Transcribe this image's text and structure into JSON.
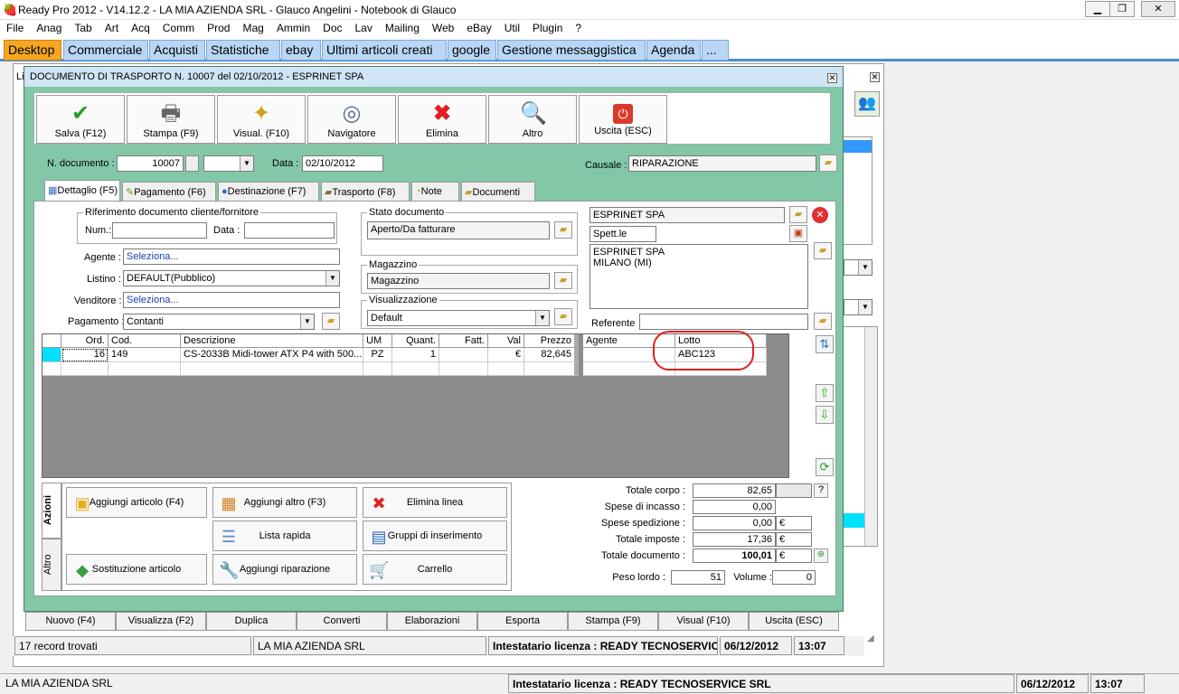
{
  "window": {
    "title": "Ready Pro 2012 - V14.12.2 - LA MIA AZIENDA SRL - Glauco Angelini - Notebook di Glauco"
  },
  "menu": [
    "File",
    "Anag",
    "Tab",
    "Art",
    "Acq",
    "Comm",
    "Prod",
    "Mag",
    "Ammin",
    "Doc",
    "Lav",
    "Mailing",
    "Web",
    "eBay",
    "Util",
    "Plugin",
    "?"
  ],
  "tabs": [
    "Desktop",
    "Commerciale",
    "Acquisti",
    "Statistiche",
    "ebay",
    "Ultimi articoli creati",
    "google",
    "Gestione messaggistica",
    "Agenda",
    "..."
  ],
  "bg": {
    "partial_label": "Li"
  },
  "dialog": {
    "title": "DOCUMENTO DI TRASPORTO N. 10007  del 02/10/2012 - ESPRINET SPA",
    "toolbar": [
      "Salva (F12)",
      "Stampa (F9)",
      "Visual. (F10)",
      "Navigatore",
      "Elimina",
      "Altro",
      "Uscita (ESC)"
    ],
    "ndoc_label": "N. documento :",
    "ndoc_value": "10007",
    "data_label": "Data :",
    "data_value": "02/10/2012",
    "causale_label": "Causale :",
    "causale_value": "RIPARAZIONE",
    "tabs": [
      "Dettaglio (F5)",
      "Pagamento (F6)",
      "Destinazione (F7)",
      "Trasporto (F8)",
      "Note",
      "Documenti"
    ],
    "rif": {
      "title": "Riferimento documento cliente/fornitore",
      "num_label": "Num.:",
      "data_label": "Data :"
    },
    "agente": {
      "label": "Agente :",
      "value": "Seleziona..."
    },
    "listino": {
      "label": "Listino :",
      "value": "DEFAULT(Pubblico)"
    },
    "venditore": {
      "label": "Venditore :",
      "value": "Seleziona..."
    },
    "pagamento": {
      "label": "Pagamento :",
      "value": "Contanti"
    },
    "stato": {
      "title": "Stato documento",
      "value": "Aperto/Da fatturare"
    },
    "magazzino": {
      "title": "Magazzino",
      "value": "Magazzino"
    },
    "visualizzazione": {
      "title": "Visualizzazione",
      "value": "Default"
    },
    "cliente": {
      "name": "ESPRINET SPA",
      "spett": "Spett.le",
      "address_line1": "ESPRINET SPA",
      "address_line2": "MILANO (MI)",
      "referente_label": "Referente"
    },
    "grid": {
      "headers": [
        "Ord.",
        "Cod.",
        "Descrizione",
        "UM",
        "Quant.",
        "Fatt.",
        "Val",
        "Prezzo",
        "Agente",
        "Lotto"
      ],
      "row": [
        "16",
        "149",
        "CS-2033B Midi-tower ATX P4 with 500...",
        "PZ",
        "1",
        "",
        "€",
        "82,645",
        "",
        "ABC123"
      ]
    },
    "actions": {
      "tab_azioni": "Azioni",
      "tab_altro": "Altro",
      "buttons": [
        "Aggiungi articolo (F4)",
        "Aggiungi altro (F3)",
        "Elimina linea",
        "Lista rapida",
        "Gruppi di inserimento",
        "Sostituzione articolo",
        "Aggiungi riparazione",
        "Carrello"
      ]
    },
    "totals": {
      "totale_corpo_label": "Totale corpo :",
      "totale_corpo": "82,65",
      "help": "?",
      "spese_incasso_label": "Spese di incasso :",
      "spese_incasso": "0,00",
      "spese_spedizione_label": "Spese spedizione :",
      "spese_spedizione": "0,00",
      "totale_imposte_label": "Totale imposte :",
      "totale_imposte": "17,36",
      "totale_documento_label": "Totale documento :",
      "totale_documento": "100,01",
      "currency": "€",
      "peso_label": "Peso lordo :",
      "peso": "51",
      "volume_label": "Volume :",
      "volume": "0"
    }
  },
  "bottom_buttons": [
    "Nuovo (F4)",
    "Visualizza (F2)",
    "Duplica",
    "Converti",
    "Elaborazioni",
    "Esporta",
    "Stampa (F9)",
    "Visual (F10)",
    "Uscita (ESC)"
  ],
  "status1": {
    "records": "17 record trovati",
    "company": "LA MIA AZIENDA SRL",
    "license": "Intestatario licenza : READY TECNOSERVIC",
    "date": "06/12/2012",
    "time": "13:07"
  },
  "status2": {
    "company": "LA MIA AZIENDA SRL",
    "license": "Intestatario licenza : READY TECNOSERVICE SRL",
    "date": "06/12/2012",
    "time": "13:07"
  },
  "colors": {
    "dialog_bg": "#82c8a8",
    "active_tab": "#f5a623",
    "highlight": "#e02020"
  }
}
